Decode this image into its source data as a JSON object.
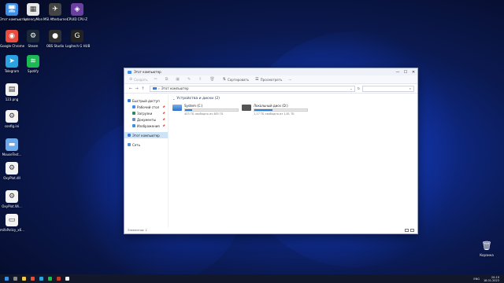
{
  "desktop": {
    "icons": [
      {
        "name": "this-pc-desktop-icon",
        "label": "Этот компьютер",
        "glyph": "🖥",
        "color": "#3b8fe5"
      },
      {
        "name": "latencymon-desktop-icon",
        "label": "LatencyMon",
        "glyph": "▦",
        "color": "#e8e8e8"
      },
      {
        "name": "msi-afterburner-desktop-icon",
        "label": "MSI Afterburner",
        "glyph": "✈",
        "color": "#444444"
      },
      {
        "name": "cpuid-desktop-icon",
        "label": "CPUID CPU-Z",
        "glyph": "◈",
        "color": "#6b3fa0"
      },
      {
        "name": "chrome-desktop-icon",
        "label": "Google Chrome",
        "glyph": "◉",
        "color": "#e74c3c"
      },
      {
        "name": "steam-desktop-icon",
        "label": "Steam",
        "glyph": "⚙",
        "color": "#1b2838"
      },
      {
        "name": "obs-desktop-icon",
        "label": "OBS Studio",
        "glyph": "●",
        "color": "#303030"
      },
      {
        "name": "logitech-desktop-icon",
        "label": "Logitech G HUB",
        "glyph": "G",
        "color": "#222222"
      },
      {
        "name": "telegram-desktop-icon",
        "label": "Telegram",
        "glyph": "➤",
        "color": "#2aa3e0"
      },
      {
        "name": "spotify-desktop-icon",
        "label": "Spotify",
        "glyph": "≋",
        "color": "#1db954"
      },
      {
        "name": "file-123-desktop-icon",
        "label": "123.png",
        "glyph": "▤",
        "color": "#f3f3f3"
      },
      {
        "name": "config-desktop-icon",
        "label": "config.ini",
        "glyph": "⚙",
        "color": "#f3f3f3"
      },
      {
        "name": "mousetest-desktop-icon",
        "label": "MouseTest...",
        "glyph": "▬",
        "color": "#6fa8e8"
      },
      {
        "name": "oxyplot-dll-desktop-icon",
        "label": "OxyPlot.dll",
        "glyph": "⚙",
        "color": "#f3f3f3"
      },
      {
        "name": "oxyplot-wi-desktop-icon",
        "label": "OxyPlot.Wi...",
        "glyph": "⚙",
        "color": "#f3f3f3"
      },
      {
        "name": "mifxpolicy-desktop-icon",
        "label": "mifxPolicy_x6...",
        "glyph": "▭",
        "color": "#f3f3f3"
      }
    ],
    "recycle_bin": {
      "label": "Корзина",
      "glyph": "🗑"
    }
  },
  "window": {
    "title": "Этот компьютер",
    "minimize": "—",
    "maximize": "☐",
    "close": "✕",
    "toolbar": {
      "create": "Создать",
      "sort": "Сортировать",
      "view": "Просмотреть",
      "more": "···"
    },
    "address": {
      "path": "Этот компьютер",
      "separator": "›",
      "back": "←",
      "forward": "→",
      "up": "↑",
      "refresh": "↻",
      "search_icon": "⌕"
    },
    "nav": {
      "quick_access": "Быстрый доступ",
      "pinned": [
        {
          "name": "nav-desktop",
          "label": "Рабочий стол",
          "color": "#3b8fe5"
        },
        {
          "name": "nav-downloads",
          "label": "Загрузки",
          "color": "#2e8b57"
        },
        {
          "name": "nav-documents",
          "label": "Документы",
          "color": "#6f8bb5"
        },
        {
          "name": "nav-pictures",
          "label": "Изображения",
          "color": "#3b8fe5"
        }
      ],
      "this_pc": "Этот компьютер",
      "network": "Сеть"
    },
    "content": {
      "section_title": "Устройства и диски (2)",
      "drives": [
        {
          "name": "System (C:)",
          "free": "403 ГБ свободно из 465 ГБ",
          "used_fraction": 0.13
        },
        {
          "name": "Локальный диск (D:)",
          "free": "1,17 ТБ свободно из 1,81 ТБ",
          "used_fraction": 0.35
        }
      ]
    },
    "status": {
      "elements": "Элементов: 2"
    }
  },
  "taskbar": {
    "tray": {
      "lang": "ENG",
      "time": "20:19",
      "date": "18.01.2023"
    }
  }
}
